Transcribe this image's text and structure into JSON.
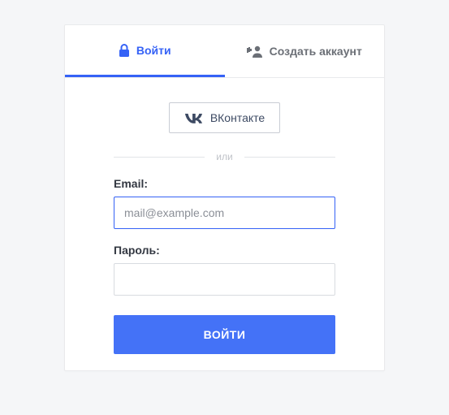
{
  "tabs": {
    "login": "Войти",
    "register": "Создать аккаунт"
  },
  "social": {
    "vk_label": "ВКонтакте"
  },
  "divider_text": "или",
  "form": {
    "email_label": "Email:",
    "email_placeholder": "mail@example.com",
    "email_value": "",
    "password_label": "Пароль:",
    "password_value": ""
  },
  "submit_label": "ВОЙТИ"
}
